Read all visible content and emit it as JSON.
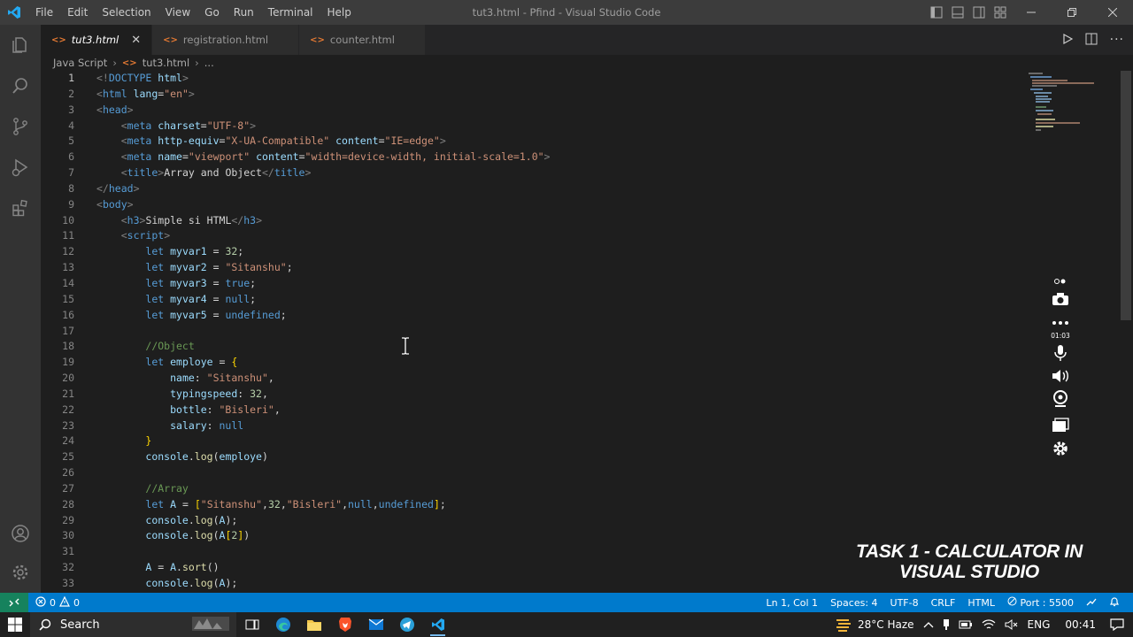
{
  "app": {
    "window_title": "tut3.html - Pfind - Visual Studio Code",
    "menu": [
      "File",
      "Edit",
      "Selection",
      "View",
      "Go",
      "Run",
      "Terminal",
      "Help"
    ]
  },
  "tabs": [
    {
      "label": "tut3.html",
      "active": true
    },
    {
      "label": "registration.html",
      "active": false
    },
    {
      "label": "counter.html",
      "active": false
    }
  ],
  "breadcrumb": {
    "folder": "Java Script",
    "file": "tut3.html",
    "more": "..."
  },
  "editor": {
    "current_line": 1,
    "lines": [
      {
        "n": "1",
        "tokens": [
          [
            "t-tag",
            "<!"
          ],
          [
            "t-name",
            "DOCTYPE"
          ],
          [
            "t-txt",
            " "
          ],
          [
            "t-attr",
            "html"
          ],
          [
            "t-tag",
            ">"
          ]
        ]
      },
      {
        "n": "2",
        "tokens": [
          [
            "t-tag",
            "<"
          ],
          [
            "t-name",
            "html"
          ],
          [
            "t-txt",
            " "
          ],
          [
            "t-attr",
            "lang"
          ],
          [
            "t-txt",
            "="
          ],
          [
            "t-str",
            "\"en\""
          ],
          [
            "t-tag",
            ">"
          ]
        ]
      },
      {
        "n": "3",
        "tokens": [
          [
            "t-tag",
            "<"
          ],
          [
            "t-name",
            "head"
          ],
          [
            "t-tag",
            ">"
          ]
        ]
      },
      {
        "n": "4",
        "tokens": [
          [
            "t-txt",
            "    "
          ],
          [
            "t-tag",
            "<"
          ],
          [
            "t-name",
            "meta"
          ],
          [
            "t-txt",
            " "
          ],
          [
            "t-attr",
            "charset"
          ],
          [
            "t-txt",
            "="
          ],
          [
            "t-str",
            "\"UTF-8\""
          ],
          [
            "t-tag",
            ">"
          ]
        ]
      },
      {
        "n": "5",
        "tokens": [
          [
            "t-txt",
            "    "
          ],
          [
            "t-tag",
            "<"
          ],
          [
            "t-name",
            "meta"
          ],
          [
            "t-txt",
            " "
          ],
          [
            "t-attr",
            "http-equiv"
          ],
          [
            "t-txt",
            "="
          ],
          [
            "t-str",
            "\"X-UA-Compatible\""
          ],
          [
            "t-txt",
            " "
          ],
          [
            "t-attr",
            "content"
          ],
          [
            "t-txt",
            "="
          ],
          [
            "t-str",
            "\"IE=edge\""
          ],
          [
            "t-tag",
            ">"
          ]
        ]
      },
      {
        "n": "6",
        "tokens": [
          [
            "t-txt",
            "    "
          ],
          [
            "t-tag",
            "<"
          ],
          [
            "t-name",
            "meta"
          ],
          [
            "t-txt",
            " "
          ],
          [
            "t-attr",
            "name"
          ],
          [
            "t-txt",
            "="
          ],
          [
            "t-str",
            "\"viewport\""
          ],
          [
            "t-txt",
            " "
          ],
          [
            "t-attr",
            "content"
          ],
          [
            "t-txt",
            "="
          ],
          [
            "t-str",
            "\"width=device-width, initial-scale=1.0\""
          ],
          [
            "t-tag",
            ">"
          ]
        ]
      },
      {
        "n": "7",
        "tokens": [
          [
            "t-txt",
            "    "
          ],
          [
            "t-tag",
            "<"
          ],
          [
            "t-name",
            "title"
          ],
          [
            "t-tag",
            ">"
          ],
          [
            "t-txt",
            "Array and Object"
          ],
          [
            "t-tag",
            "</"
          ],
          [
            "t-name",
            "title"
          ],
          [
            "t-tag",
            ">"
          ]
        ]
      },
      {
        "n": "8",
        "tokens": [
          [
            "t-tag",
            "</"
          ],
          [
            "t-name",
            "head"
          ],
          [
            "t-tag",
            ">"
          ]
        ]
      },
      {
        "n": "9",
        "tokens": [
          [
            "t-tag",
            "<"
          ],
          [
            "t-name",
            "body"
          ],
          [
            "t-tag",
            ">"
          ]
        ]
      },
      {
        "n": "10",
        "tokens": [
          [
            "t-txt",
            "    "
          ],
          [
            "t-tag",
            "<"
          ],
          [
            "t-name",
            "h3"
          ],
          [
            "t-tag",
            ">"
          ],
          [
            "t-txt",
            "Simple si HTML"
          ],
          [
            "t-tag",
            "</"
          ],
          [
            "t-name",
            "h3"
          ],
          [
            "t-tag",
            ">"
          ]
        ]
      },
      {
        "n": "11",
        "tokens": [
          [
            "t-txt",
            "    "
          ],
          [
            "t-tag",
            "<"
          ],
          [
            "t-name",
            "script"
          ],
          [
            "t-tag",
            ">"
          ]
        ]
      },
      {
        "n": "12",
        "tokens": [
          [
            "t-txt",
            "        "
          ],
          [
            "t-kw",
            "let"
          ],
          [
            "t-txt",
            " "
          ],
          [
            "t-var",
            "myvar1"
          ],
          [
            "t-txt",
            " = "
          ],
          [
            "t-num",
            "32"
          ],
          [
            "t-txt",
            ";"
          ]
        ]
      },
      {
        "n": "13",
        "tokens": [
          [
            "t-txt",
            "        "
          ],
          [
            "t-kw",
            "let"
          ],
          [
            "t-txt",
            " "
          ],
          [
            "t-var",
            "myvar2"
          ],
          [
            "t-txt",
            " = "
          ],
          [
            "t-str",
            "\"Sitanshu\""
          ],
          [
            "t-txt",
            ";"
          ]
        ]
      },
      {
        "n": "14",
        "tokens": [
          [
            "t-txt",
            "        "
          ],
          [
            "t-kw",
            "let"
          ],
          [
            "t-txt",
            " "
          ],
          [
            "t-var",
            "myvar3"
          ],
          [
            "t-txt",
            " = "
          ],
          [
            "t-kw",
            "true"
          ],
          [
            "t-txt",
            ";"
          ]
        ]
      },
      {
        "n": "15",
        "tokens": [
          [
            "t-txt",
            "        "
          ],
          [
            "t-kw",
            "let"
          ],
          [
            "t-txt",
            " "
          ],
          [
            "t-var",
            "myvar4"
          ],
          [
            "t-txt",
            " = "
          ],
          [
            "t-kw",
            "null"
          ],
          [
            "t-txt",
            ";"
          ]
        ]
      },
      {
        "n": "16",
        "tokens": [
          [
            "t-txt",
            "        "
          ],
          [
            "t-kw",
            "let"
          ],
          [
            "t-txt",
            " "
          ],
          [
            "t-var",
            "myvar5"
          ],
          [
            "t-txt",
            " = "
          ],
          [
            "t-kw",
            "undefined"
          ],
          [
            "t-txt",
            ";"
          ]
        ]
      },
      {
        "n": "17",
        "tokens": []
      },
      {
        "n": "18",
        "tokens": [
          [
            "t-txt",
            "        "
          ],
          [
            "t-com",
            "//Object"
          ]
        ]
      },
      {
        "n": "19",
        "tokens": [
          [
            "t-txt",
            "        "
          ],
          [
            "t-kw",
            "let"
          ],
          [
            "t-txt",
            " "
          ],
          [
            "t-var",
            "employe"
          ],
          [
            "t-txt",
            " = "
          ],
          [
            "t-br",
            "{"
          ]
        ]
      },
      {
        "n": "20",
        "tokens": [
          [
            "t-txt",
            "            "
          ],
          [
            "t-var",
            "name"
          ],
          [
            "t-txt",
            ": "
          ],
          [
            "t-str",
            "\"Sitanshu\""
          ],
          [
            "t-txt",
            ","
          ]
        ]
      },
      {
        "n": "21",
        "tokens": [
          [
            "t-txt",
            "            "
          ],
          [
            "t-var",
            "typingspeed"
          ],
          [
            "t-txt",
            ": "
          ],
          [
            "t-num",
            "32"
          ],
          [
            "t-txt",
            ","
          ]
        ]
      },
      {
        "n": "22",
        "tokens": [
          [
            "t-txt",
            "            "
          ],
          [
            "t-var",
            "bottle"
          ],
          [
            "t-txt",
            ": "
          ],
          [
            "t-str",
            "\"Bisleri\""
          ],
          [
            "t-txt",
            ","
          ]
        ]
      },
      {
        "n": "23",
        "tokens": [
          [
            "t-txt",
            "            "
          ],
          [
            "t-var",
            "salary"
          ],
          [
            "t-txt",
            ": "
          ],
          [
            "t-kw",
            "null"
          ]
        ]
      },
      {
        "n": "24",
        "tokens": [
          [
            "t-txt",
            "        "
          ],
          [
            "t-br",
            "}"
          ]
        ]
      },
      {
        "n": "25",
        "tokens": [
          [
            "t-txt",
            "        "
          ],
          [
            "t-var",
            "console"
          ],
          [
            "t-txt",
            "."
          ],
          [
            "t-fn",
            "log"
          ],
          [
            "t-txt",
            "("
          ],
          [
            "t-var",
            "employe"
          ],
          [
            "t-txt",
            ")"
          ]
        ]
      },
      {
        "n": "26",
        "tokens": []
      },
      {
        "n": "27",
        "tokens": [
          [
            "t-txt",
            "        "
          ],
          [
            "t-com",
            "//Array"
          ]
        ]
      },
      {
        "n": "28",
        "tokens": [
          [
            "t-txt",
            "        "
          ],
          [
            "t-kw",
            "let"
          ],
          [
            "t-txt",
            " "
          ],
          [
            "t-var",
            "A"
          ],
          [
            "t-txt",
            " = "
          ],
          [
            "t-br",
            "["
          ],
          [
            "t-str",
            "\"Sitanshu\""
          ],
          [
            "t-txt",
            ","
          ],
          [
            "t-num",
            "32"
          ],
          [
            "t-txt",
            ","
          ],
          [
            "t-str",
            "\"Bisleri\""
          ],
          [
            "t-txt",
            ","
          ],
          [
            "t-kw",
            "null"
          ],
          [
            "t-txt",
            ","
          ],
          [
            "t-kw",
            "undefined"
          ],
          [
            "t-br",
            "]"
          ],
          [
            "t-txt",
            ";"
          ]
        ]
      },
      {
        "n": "29",
        "tokens": [
          [
            "t-txt",
            "        "
          ],
          [
            "t-var",
            "console"
          ],
          [
            "t-txt",
            "."
          ],
          [
            "t-fn",
            "log"
          ],
          [
            "t-txt",
            "("
          ],
          [
            "t-var",
            "A"
          ],
          [
            "t-txt",
            ");"
          ]
        ]
      },
      {
        "n": "30",
        "tokens": [
          [
            "t-txt",
            "        "
          ],
          [
            "t-var",
            "console"
          ],
          [
            "t-txt",
            "."
          ],
          [
            "t-fn",
            "log"
          ],
          [
            "t-txt",
            "("
          ],
          [
            "t-var",
            "A"
          ],
          [
            "t-br",
            "["
          ],
          [
            "t-num",
            "2"
          ],
          [
            "t-br",
            "]"
          ],
          [
            "t-txt",
            ")"
          ]
        ]
      },
      {
        "n": "31",
        "tokens": []
      },
      {
        "n": "32",
        "tokens": [
          [
            "t-txt",
            "        "
          ],
          [
            "t-var",
            "A"
          ],
          [
            "t-txt",
            " = "
          ],
          [
            "t-var",
            "A"
          ],
          [
            "t-txt",
            "."
          ],
          [
            "t-fn",
            "sort"
          ],
          [
            "t-txt",
            "()"
          ]
        ]
      },
      {
        "n": "33",
        "tokens": [
          [
            "t-txt",
            "        "
          ],
          [
            "t-var",
            "console"
          ],
          [
            "t-txt",
            "."
          ],
          [
            "t-fn",
            "log"
          ],
          [
            "t-txt",
            "("
          ],
          [
            "t-var",
            "A"
          ],
          [
            "t-txt",
            ");"
          ]
        ]
      }
    ]
  },
  "recorder": {
    "timer": "01:03"
  },
  "watermark": {
    "line1": "TASK 1 - CALCULATOR IN",
    "line2": "VISUAL STUDIO"
  },
  "statusbar": {
    "errors": "0",
    "warnings": "0",
    "position": "Ln 1, Col 1",
    "spaces": "Spaces: 4",
    "encoding": "UTF-8",
    "eol": "CRLF",
    "language": "HTML",
    "port": "Port : 5500"
  },
  "taskbar": {
    "search_label": "Search",
    "weather": "28°C Haze",
    "language": "ENG",
    "time": "00:41"
  },
  "colors": {
    "accent": "#007acc",
    "remote": "#16825d",
    "tab_icon": "#e37933"
  }
}
